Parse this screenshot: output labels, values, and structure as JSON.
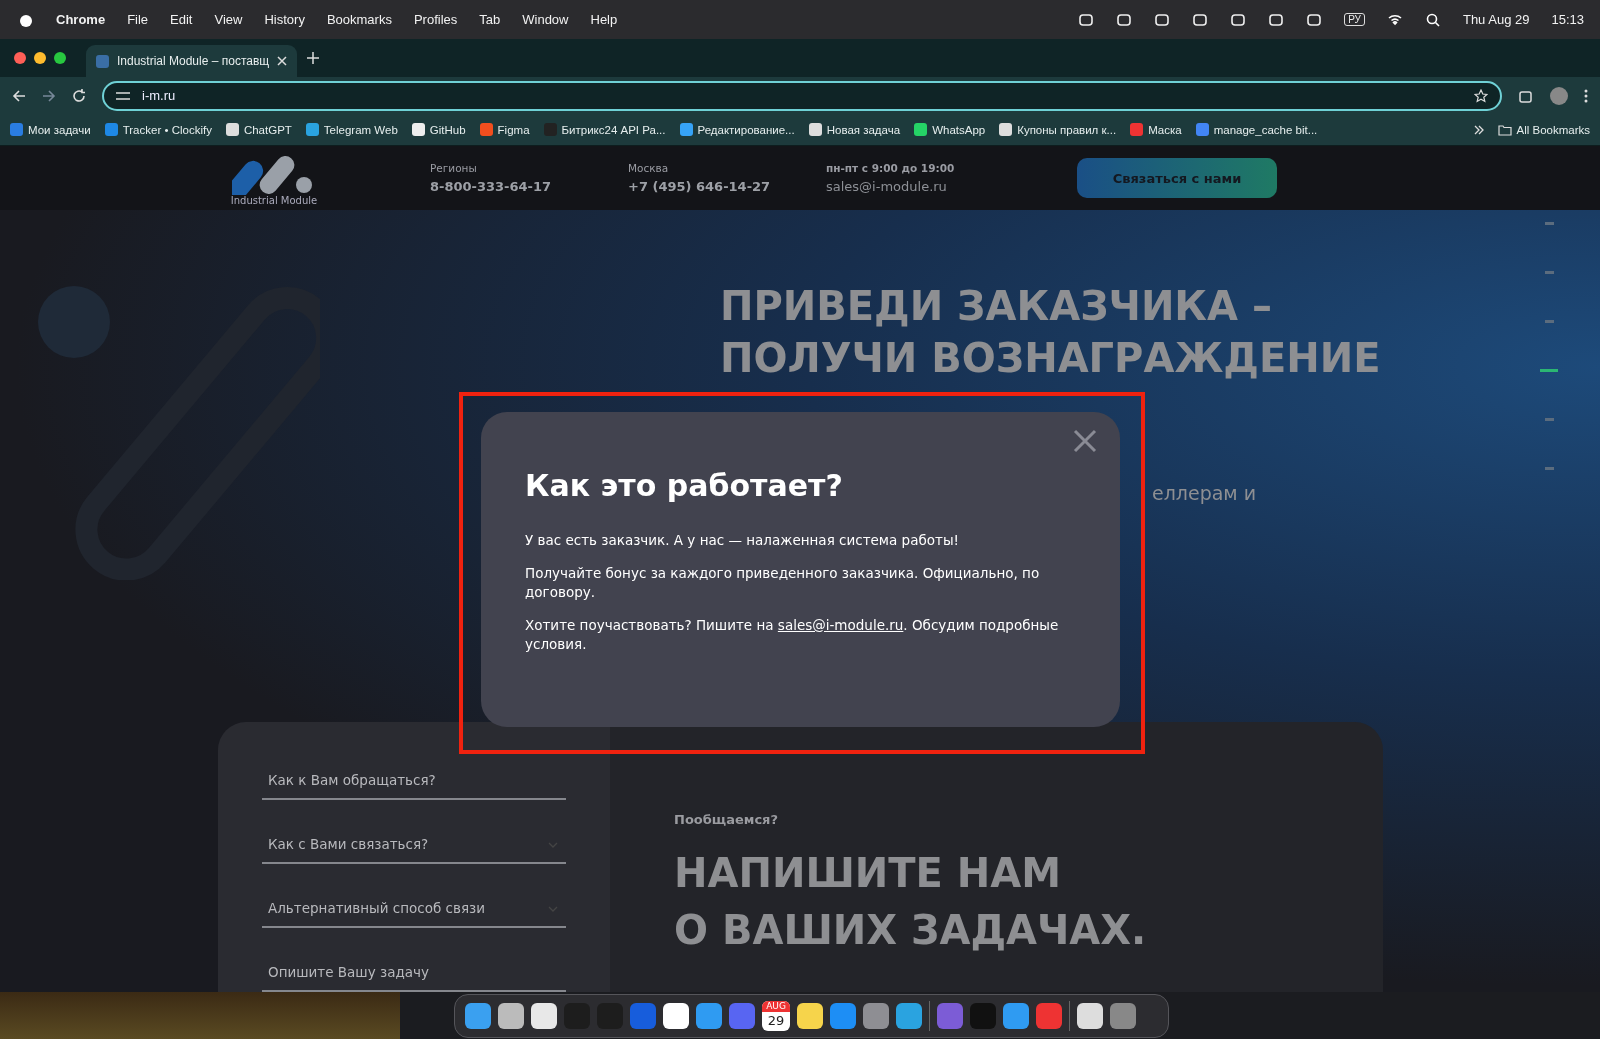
{
  "menu_bar": {
    "app": "Chrome",
    "items": [
      "File",
      "Edit",
      "View",
      "History",
      "Bookmarks",
      "Profiles",
      "Tab",
      "Window",
      "Help"
    ],
    "input_source": "РУ",
    "date": "Thu Aug 29",
    "time": "15:13"
  },
  "browser": {
    "tab": {
      "title": "Industrial Module – поставщ",
      "selected": true
    },
    "url": "i-m.ru",
    "bookmarks": [
      "Мои задачи",
      "Tracker • Clockify",
      "ChatGPT",
      "Telegram Web",
      "GitHub",
      "Figma",
      "Битрикс24 API Ра...",
      "Редактирование...",
      "Новая задача",
      "WhatsApp",
      "Купоны правил к...",
      "Маска",
      "manage_cache bit..."
    ],
    "all_bookmarks": "All Bookmarks"
  },
  "site_header": {
    "logo_text": "Industrial Module",
    "contacts": [
      {
        "label": "Регионы",
        "value": "8-800-333-64-17",
        "kind": "phone"
      },
      {
        "label": "Москва",
        "value": "+7 (495) 646-14-27",
        "kind": "phone"
      },
      {
        "label": "пн-пт с 9:00 до 19:00",
        "value": "sales@i-module.ru",
        "kind": "email"
      }
    ],
    "cta": "Связаться с нами"
  },
  "hero": {
    "title_lines": [
      "ПРИВЕДИ ЗАКАЗЧИКА –",
      "ПОЛУЧИ ВОЗНАГРАЖДЕНИЕ"
    ],
    "subtitle_fragment": "еллерам и",
    "pager": [
      {
        "selected": false
      },
      {
        "selected": false
      },
      {
        "selected": false
      },
      {
        "selected": true
      },
      {
        "selected": false
      },
      {
        "selected": false
      }
    ]
  },
  "modal": {
    "title": "Как это работает?",
    "paragraphs": [
      "У вас есть заказчик. А у нас — налаженная система работы!",
      "Получайте бонус за каждого приведенного заказчика. Официально, по договору."
    ],
    "cta_before": "Хотите поучаствовать? Пишите на ",
    "cta_link": "sales@i-module.ru",
    "cta_after": ". Обсудим подробные условия."
  },
  "contact_form": {
    "fields": [
      {
        "placeholder": "Как к Вам обращаться?",
        "kind": "text"
      },
      {
        "placeholder": "Как с Вами связаться?",
        "kind": "select"
      },
      {
        "placeholder": "Альтернативный способ связи",
        "kind": "select"
      },
      {
        "placeholder": "Опишите Вашу задачу",
        "kind": "text"
      }
    ],
    "eyebrow": "Пообщаемся?",
    "title_lines": [
      "НАПИШИТЕ НАМ",
      "О ВАШИХ ЗАДАЧАХ."
    ]
  },
  "dock": {
    "calendar_month": "AUG",
    "calendar_day": "29"
  }
}
